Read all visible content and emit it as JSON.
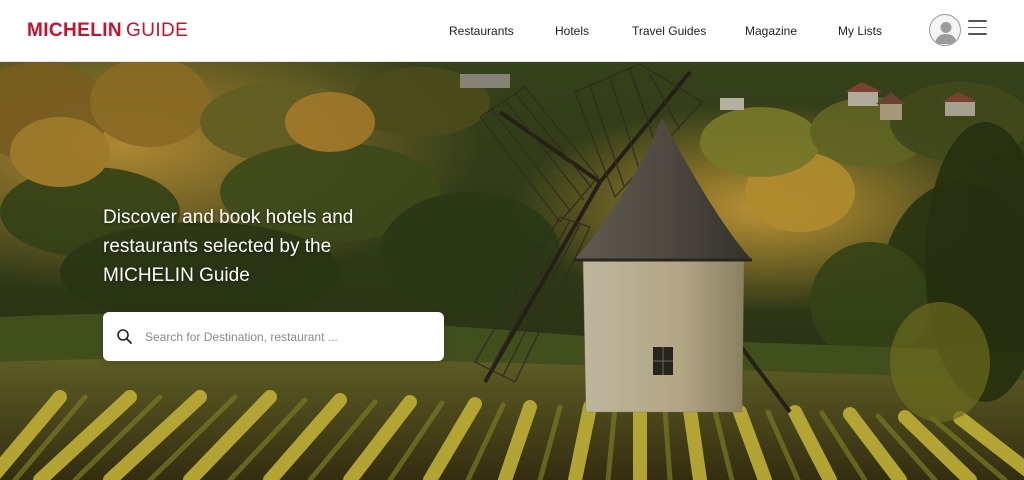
{
  "header": {
    "logo": {
      "brand": "MICHELIN",
      "suffix": "GUIDE"
    },
    "nav": [
      {
        "label": "Restaurants"
      },
      {
        "label": "Hotels"
      },
      {
        "label": "Travel Guides"
      },
      {
        "label": "Magazine"
      },
      {
        "label": "My Lists"
      }
    ],
    "user_icon": "user-avatar-icon",
    "menu_icon": "hamburger-menu-icon"
  },
  "hero": {
    "headline": "Discover and book hotels and restaurants selected by the MICHELIN Guide",
    "search": {
      "placeholder": "Search for Destination, restaurant ...",
      "value": "",
      "icon": "search-icon"
    },
    "image": "windmill-vineyard-photo"
  },
  "colors": {
    "brand_red": "#c4122f",
    "nav_text": "#222222",
    "headline_text": "#ffffff"
  }
}
